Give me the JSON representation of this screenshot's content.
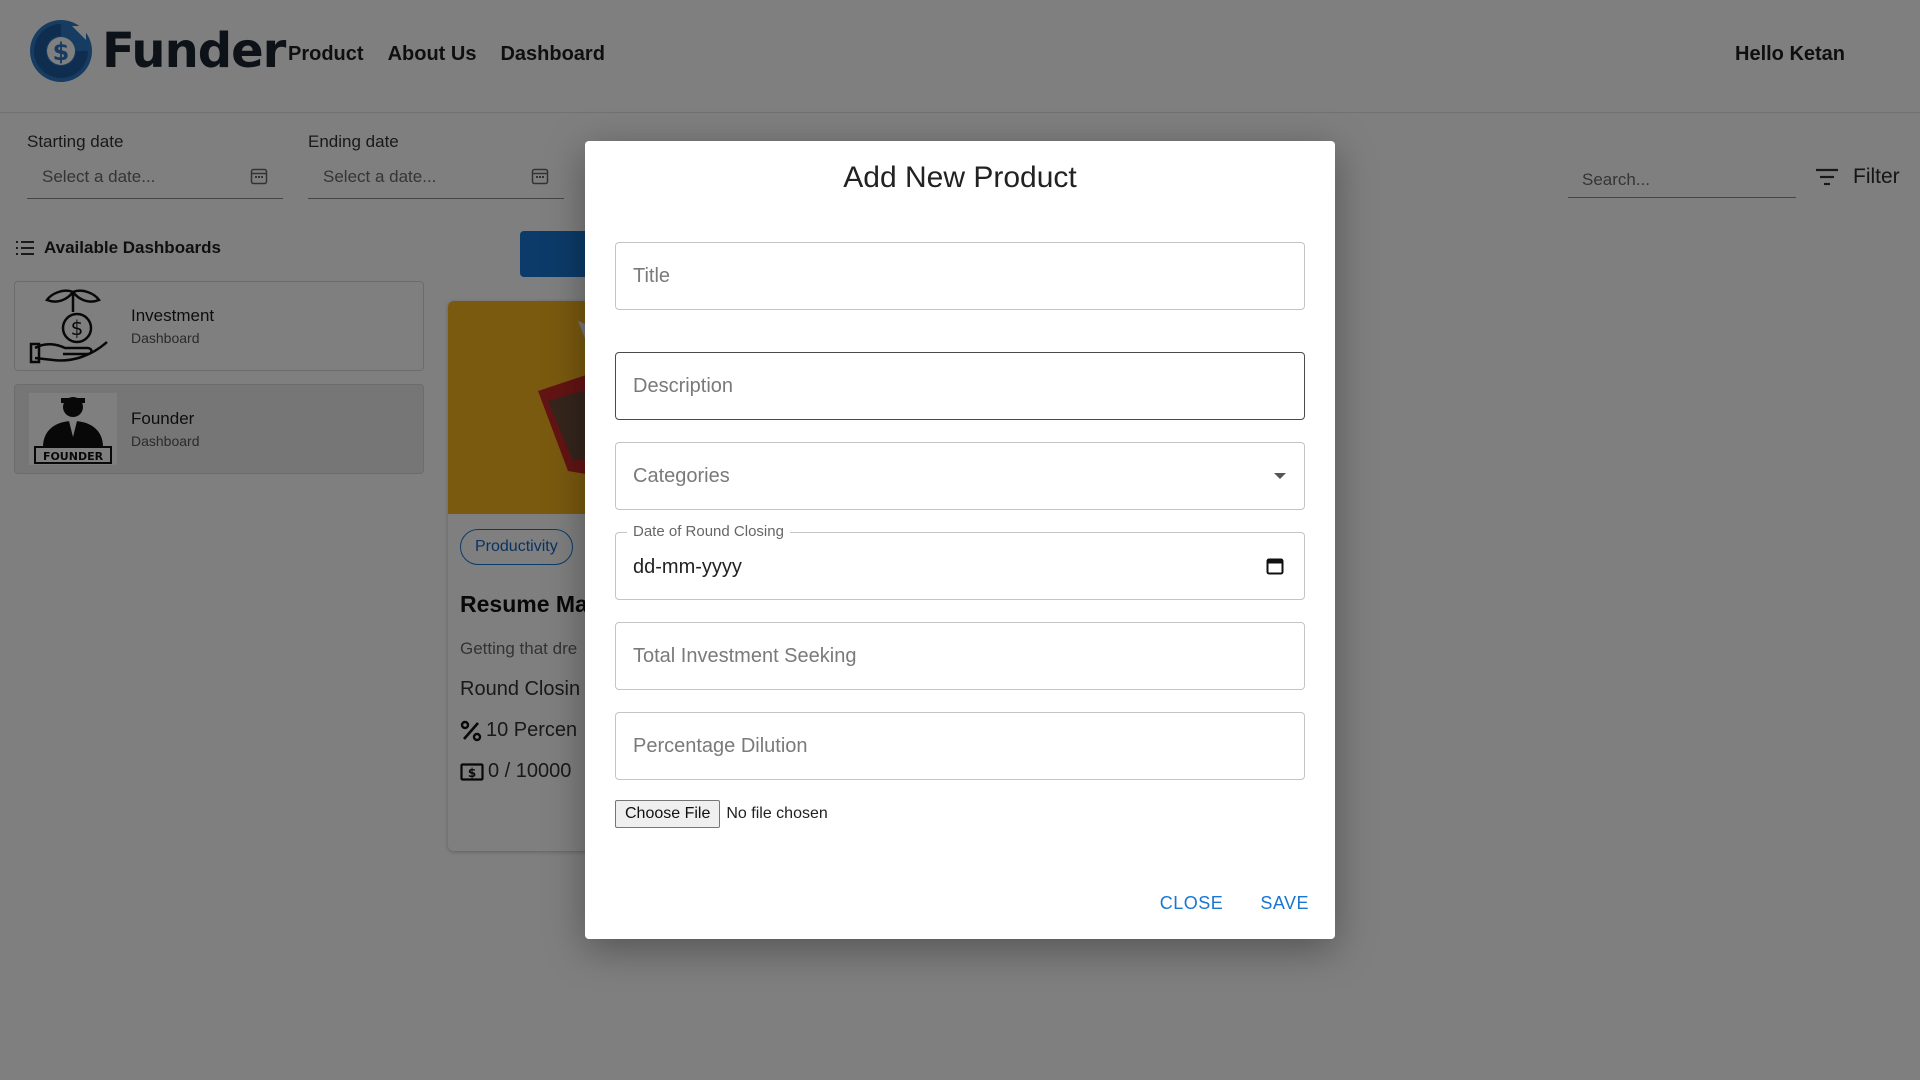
{
  "header": {
    "brand": "Funder",
    "nav": [
      "Product",
      "About Us",
      "Dashboard"
    ],
    "greeting": "Hello Ketan"
  },
  "filters": {
    "start_label": "Starting date",
    "start_placeholder": "Select a date...",
    "end_label": "Ending date",
    "end_placeholder": "Select a date...",
    "search_placeholder": "Search...",
    "filter_label": "Filter"
  },
  "sidebar": {
    "title": "Available Dashboards",
    "items": [
      {
        "name": "Investment",
        "subtitle": "Dashboard"
      },
      {
        "name": "Founder",
        "subtitle": "Dashboard",
        "badge": "FOUNDER",
        "selected": true
      }
    ]
  },
  "product_card": {
    "category": "Productivity",
    "title": "Resume Ma",
    "description": "Getting that dre",
    "round_closing": "Round Closin",
    "percentage": "10 Percen",
    "investment": "0 / 10000"
  },
  "modal": {
    "title": "Add New Product",
    "fields": {
      "title_ph": "Title",
      "description_ph": "Description",
      "categories_ph": "Categories",
      "date_legend": "Date of Round Closing",
      "date_value": "dd-mm-yyyy",
      "investment_ph": "Total Investment Seeking",
      "dilution_ph": "Percentage Dilution"
    },
    "file_button": "Choose File",
    "file_status": "No file chosen",
    "close_label": "CLOSE",
    "save_label": "SAVE"
  },
  "colors": {
    "accent": "#1976d2",
    "brand_blue": "#2f78c4",
    "card_image": "#f4b51e"
  }
}
